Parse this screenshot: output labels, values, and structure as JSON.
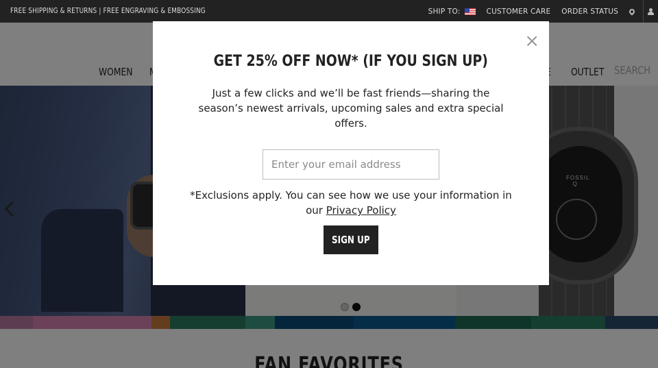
{
  "topbar": {
    "promo": "FREE SHIPPING & RETURNS | FREE ENGRAVING & EMBOSSING",
    "ship_to": "SHIP TO:",
    "customer_care": "CUSTOMER CARE",
    "order_status": "ORDER STATUS"
  },
  "nav": {
    "women": "WOMEN",
    "men_partial": "M",
    "sale_partial": "E",
    "outlet": "OUTLET",
    "search_placeholder": "SEARCH"
  },
  "hero": {
    "watch_brand": "FOSSIL",
    "watch_sub": "Q"
  },
  "strip_colors": [
    "#b87aa0",
    "#d783b0",
    "#c77a3a",
    "#2a7a60",
    "#3a9a80",
    "#0a4a7a",
    "#0d5a90",
    "#1e6a56",
    "#2a7a60",
    "#2a4a6a"
  ],
  "section": {
    "title": "FAN FAVORITES"
  },
  "modal": {
    "title": "GET 25% OFF NOW* (IF YOU SIGN UP)",
    "description": "Just a few clicks and we’ll be fast friends—sharing the season’s newest arrivals, upcoming sales and extra special offers.",
    "email_placeholder": "Enter your email address",
    "exclusions_text": "*Exclusions apply. You can see how we use your information in our ",
    "privacy_link": "Privacy Policy",
    "signup_label": "SIGN UP",
    "close_glyph": "×"
  }
}
